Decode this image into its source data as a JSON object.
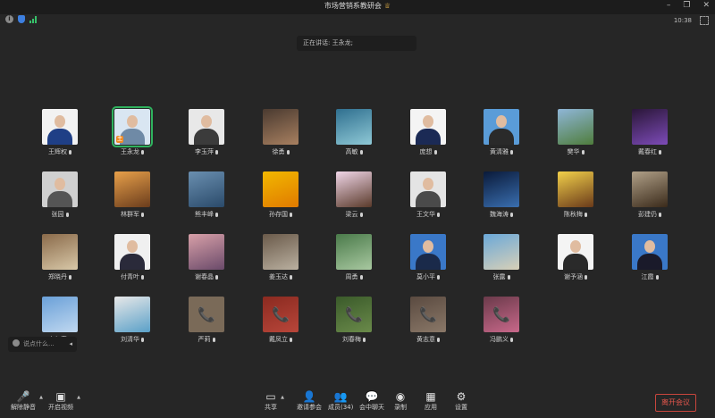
{
  "window": {
    "title": "市场营销系教研会",
    "time": "10:38"
  },
  "speaking": "正在讲话: 王永龙;",
  "participants": [
    {
      "name": "王辉权",
      "kind": "portrait",
      "colors": [
        "#f2f2f2",
        "#1f3f86"
      ]
    },
    {
      "name": "王永龙",
      "kind": "portrait",
      "colors": [
        "#d9e6f2",
        "#6f8aa6"
      ],
      "highlight": true,
      "badge": "主"
    },
    {
      "name": "李玉萍",
      "kind": "portrait",
      "colors": [
        "#e8e8e8",
        "#3b3b3b"
      ]
    },
    {
      "name": "徐勇",
      "kind": "photo",
      "colors": [
        "#4a3a30",
        "#a88060"
      ]
    },
    {
      "name": "高敏",
      "kind": "photo",
      "colors": [
        "#2f6f8f",
        "#8fc9d6"
      ]
    },
    {
      "name": "庞想",
      "kind": "portrait",
      "colors": [
        "#f4f4f4",
        "#1b2a55"
      ]
    },
    {
      "name": "黄清雅",
      "kind": "portrait",
      "colors": [
        "#5a9cd8",
        "#2a2a2a"
      ]
    },
    {
      "name": "樊华",
      "kind": "photo",
      "colors": [
        "#8fb6d8",
        "#4f7d3c"
      ]
    },
    {
      "name": "戴春红",
      "kind": "photo",
      "colors": [
        "#2a1638",
        "#7d4bb8"
      ]
    },
    {
      "name": "张园",
      "kind": "portrait",
      "colors": [
        "#d0d0d0",
        "#555555"
      ]
    },
    {
      "name": "林群军",
      "kind": "photo",
      "colors": [
        "#e8a04a",
        "#6a3c1c"
      ]
    },
    {
      "name": "熊丰峰",
      "kind": "photo",
      "colors": [
        "#6a8fb0",
        "#2a4a6a"
      ]
    },
    {
      "name": "孙存国",
      "kind": "photo",
      "colors": [
        "#f2b800",
        "#e07a00"
      ]
    },
    {
      "name": "梁云",
      "kind": "photo",
      "colors": [
        "#f0d6e8",
        "#5a3a2a"
      ]
    },
    {
      "name": "王文华",
      "kind": "portrait",
      "colors": [
        "#e4e4e4",
        "#4a4a4a"
      ]
    },
    {
      "name": "魏海涛",
      "kind": "photo",
      "colors": [
        "#0a1a3a",
        "#3a6fb0"
      ]
    },
    {
      "name": "陈秋梅",
      "kind": "photo",
      "colors": [
        "#f2d04a",
        "#6a3a1a"
      ]
    },
    {
      "name": "彭建仍",
      "kind": "photo",
      "colors": [
        "#b0a088",
        "#3a2a1a"
      ]
    },
    {
      "name": "郑晓丹",
      "kind": "photo",
      "colors": [
        "#8a6a4a",
        "#d8c8a8"
      ]
    },
    {
      "name": "付青叶",
      "kind": "portrait",
      "colors": [
        "#f0f0f0",
        "#2a2a3a"
      ]
    },
    {
      "name": "谢春晶",
      "kind": "photo",
      "colors": [
        "#d8a0a8",
        "#6a4a6a"
      ]
    },
    {
      "name": "姜玉达",
      "kind": "photo",
      "colors": [
        "#6a5a4a",
        "#bab0a0"
      ]
    },
    {
      "name": "周勇",
      "kind": "photo",
      "colors": [
        "#4a7a4a",
        "#a8c8a0"
      ]
    },
    {
      "name": "莫小平",
      "kind": "portrait",
      "colors": [
        "#3a78c8",
        "#1a2a4a"
      ]
    },
    {
      "name": "张露",
      "kind": "photo",
      "colors": [
        "#6aa8d8",
        "#d8d0b8"
      ]
    },
    {
      "name": "谢予涵",
      "kind": "portrait",
      "colors": [
        "#f4f4f4",
        "#2a2a2a"
      ]
    },
    {
      "name": "江霞",
      "kind": "portrait",
      "colors": [
        "#3a78c8",
        "#1a1a2a"
      ]
    },
    {
      "name": "白仁春",
      "kind": "photo",
      "colors": [
        "#6aa0d8",
        "#c0d8f0"
      ]
    },
    {
      "name": "刘清华",
      "kind": "photo",
      "colors": [
        "#e8e8e8",
        "#5aa0c8"
      ]
    },
    {
      "name": "严莉",
      "kind": "phone",
      "colors": [
        "#7a6a58",
        "#7a6a58"
      ]
    },
    {
      "name": "戴凤立",
      "kind": "phone",
      "colors": [
        "#8a2a20",
        "#b8463a"
      ]
    },
    {
      "name": "刘春梅",
      "kind": "phone",
      "colors": [
        "#3a5a2a",
        "#6a8a4a"
      ]
    },
    {
      "name": "黄志意",
      "kind": "phone",
      "colors": [
        "#5a4a40",
        "#8a7868"
      ]
    },
    {
      "name": "冯鹏义",
      "kind": "phone",
      "colors": [
        "#6a3a4a",
        "#c8688a"
      ]
    }
  ],
  "chat": {
    "placeholder": "说点什么..."
  },
  "toolbar": {
    "mute": "解除静音",
    "video": "开启视频",
    "share": "共享",
    "invite": "邀请参会",
    "members": "成员(34)",
    "chat": "会中聊天",
    "record": "录制",
    "apps": "应用",
    "settings": "设置",
    "leave": "离开会议"
  }
}
